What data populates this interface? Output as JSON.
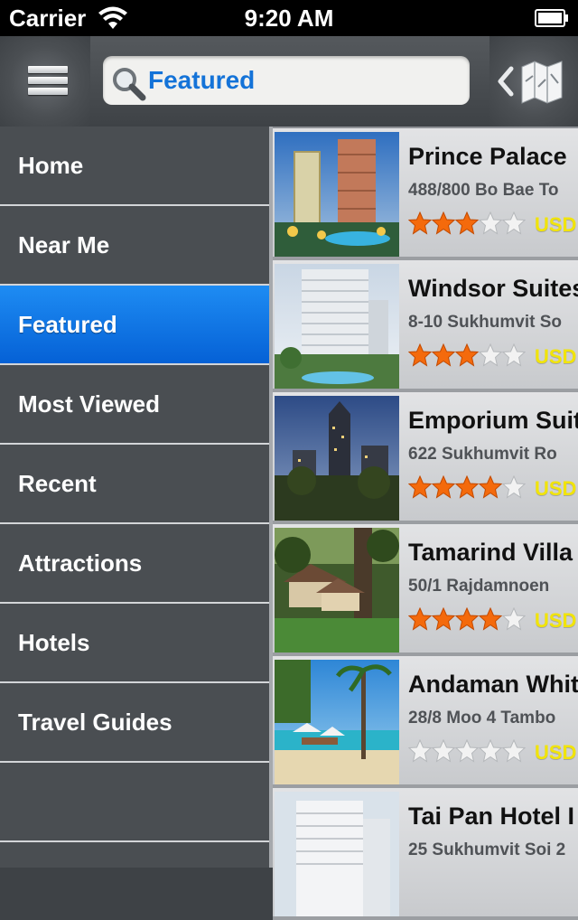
{
  "status_bar": {
    "carrier": "Carrier",
    "time": "9:20 AM"
  },
  "nav": {
    "search_text": "Featured",
    "menu_icon": "hamburger-icon",
    "map_icon": "map-icon"
  },
  "menu": {
    "items": [
      {
        "label": "Home",
        "active": false
      },
      {
        "label": "Near Me",
        "active": false
      },
      {
        "label": "Featured",
        "active": true
      },
      {
        "label": "Most Viewed",
        "active": false
      },
      {
        "label": "Recent",
        "active": false
      },
      {
        "label": "Attractions",
        "active": false
      },
      {
        "label": "Hotels",
        "active": false
      },
      {
        "label": "Travel Guides",
        "active": false
      }
    ]
  },
  "hotels": [
    {
      "name": "Prince Palace",
      "address": "488/800 Bo Bae To",
      "rating": 3,
      "price_text": "USD"
    },
    {
      "name": "Windsor Suites",
      "address": "8-10 Sukhumvit So",
      "rating": 3,
      "price_text": "USD"
    },
    {
      "name": "Emporium Suit",
      "address": "622 Sukhumvit Ro",
      "rating": 4,
      "price_text": "USD"
    },
    {
      "name": "Tamarind Villa",
      "address": "50/1 Rajdamnoen",
      "rating": 4,
      "price_text": "USD"
    },
    {
      "name": "Andaman Whit",
      "address": "28/8 Moo 4 Tambo",
      "rating": 0,
      "price_text": "USD"
    },
    {
      "name": "Tai Pan Hotel I",
      "address": "25 Sukhumvit Soi 2",
      "rating": 0,
      "price_text": ""
    }
  ],
  "colors": {
    "accent_blue": "#1473d8",
    "active_menu": "#0a6fe0",
    "price_yellow": "#f1e40a",
    "star_orange": "#f46a0c"
  }
}
